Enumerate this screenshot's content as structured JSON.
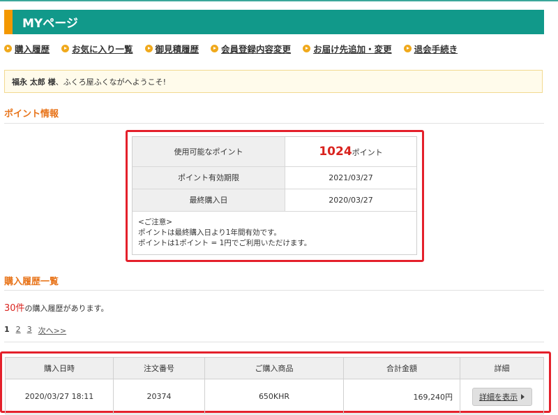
{
  "header": {
    "title": "MYページ"
  },
  "nav": [
    {
      "label": "購入履歴"
    },
    {
      "label": "お気に入り一覧"
    },
    {
      "label": "御見積履歴"
    },
    {
      "label": "会員登録内容変更"
    },
    {
      "label": "お届け先追加・変更"
    },
    {
      "label": "退会手続き"
    }
  ],
  "welcome": {
    "name": "福永 太郎 様",
    "message": "、ふくろ屋ふくながへようこそ!"
  },
  "points": {
    "section_title": "ポイント情報",
    "available_label": "使用可能なポイント",
    "available_value": "1024",
    "available_unit": "ポイント",
    "expiry_label": "ポイント有効期限",
    "expiry_value": "2021/03/27",
    "last_purchase_label": "最終購入日",
    "last_purchase_value": "2020/03/27",
    "notes": [
      "<ご注意>",
      "ポイントは最終購入日より1年間有効です。",
      "ポイントは1ポイント = 1円でご利用いただけます。"
    ]
  },
  "history": {
    "section_title": "購入履歴一覧",
    "count": "30件",
    "count_suffix": "の購入履歴があります。",
    "pager": {
      "pages": [
        "1",
        "2",
        "3"
      ],
      "next": "次へ>>"
    },
    "columns": [
      "購入日時",
      "注文番号",
      "ご購入商品",
      "合計金額",
      "詳細"
    ],
    "rows": [
      {
        "date": "2020/03/27 18:11",
        "order_no": "20374",
        "product": "650KHR",
        "total": "169,240円",
        "detail_button": "詳細を表示"
      }
    ]
  },
  "colors": {
    "header_bg": "#11998a",
    "accent_orange": "#f39800",
    "highlight_red": "#e4202b",
    "section_title": "#e8741a"
  }
}
